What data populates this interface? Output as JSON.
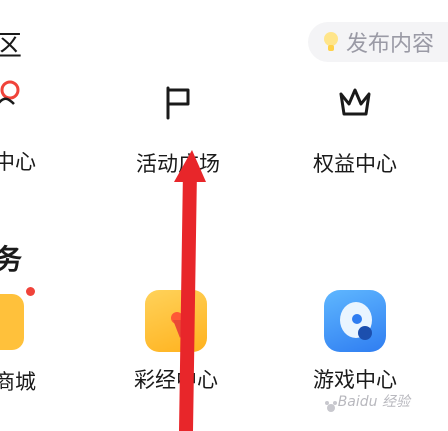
{
  "header": {
    "left_title": "区",
    "publish_text": "发布内容"
  },
  "left_column": {
    "label_1": "中心",
    "section": "务",
    "label_2": "商城"
  },
  "grid": {
    "items": [
      {
        "label": "活动广场",
        "icon": "flag-icon"
      },
      {
        "label": "权益中心",
        "icon": "crown-icon"
      },
      {
        "label": "彩经中心",
        "icon": "lottery-icon"
      },
      {
        "label": "游戏中心",
        "icon": "game-icon"
      }
    ]
  },
  "annotation": {
    "color": "#e8262a"
  },
  "watermark": {
    "text": "Baidu 经验"
  }
}
